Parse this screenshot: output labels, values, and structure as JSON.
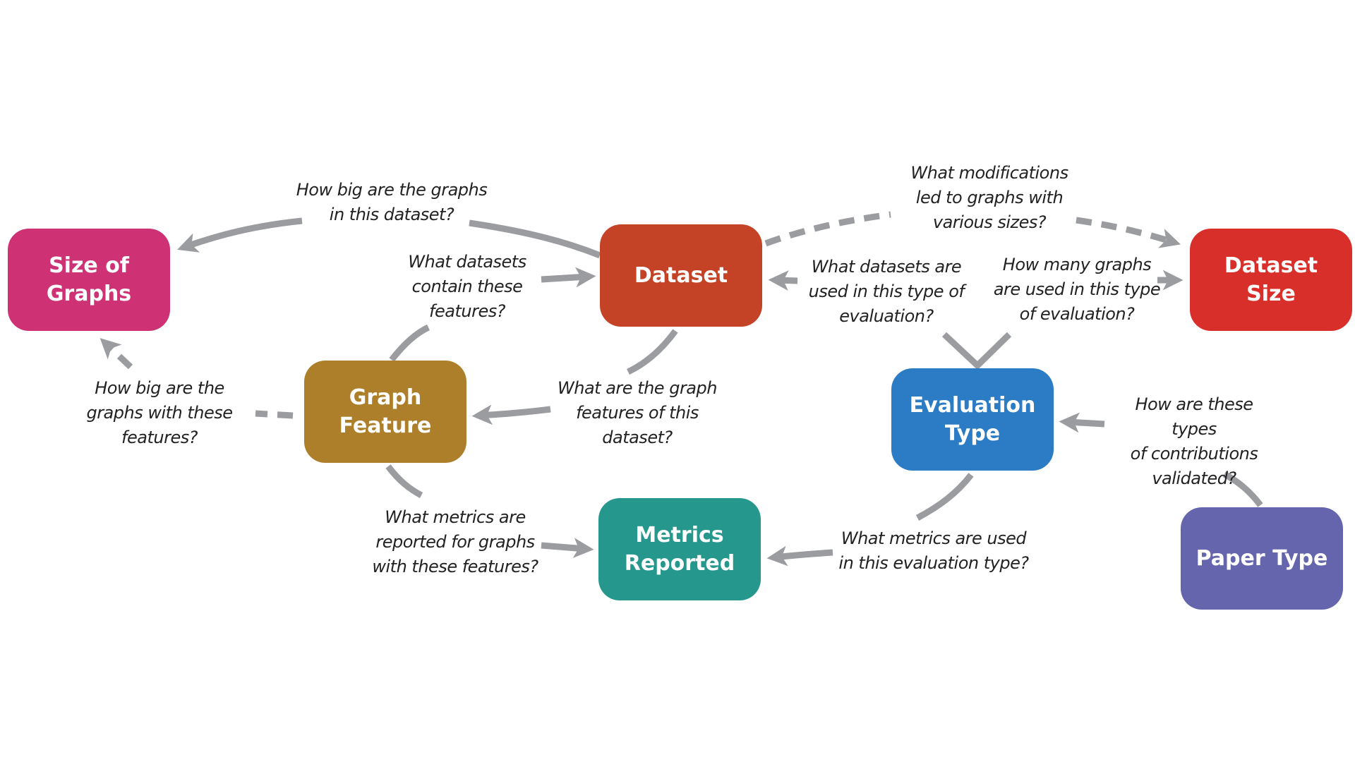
{
  "colors": {
    "edge": "#9a9c9f",
    "size_of_graphs": "#CE3174",
    "dataset": "#C44326",
    "dataset_size": "#D82F2B",
    "graph_feature": "#AD7F2B",
    "evaluation_type": "#2B7CC4",
    "metrics_reported": "#26978C",
    "paper_type": "#6465AD"
  },
  "nodes": {
    "size_of_graphs": "Size of\nGraphs",
    "dataset": "Dataset",
    "dataset_size": "Dataset Size",
    "graph_feature": "Graph\nFeature",
    "evaluation_type": "Evaluation\nType",
    "metrics_reported": "Metrics\nReported",
    "paper_type": "Paper Type"
  },
  "questions": {
    "dataset_to_size": "How big are the graphs\nin this dataset?",
    "feature_to_dataset": "What datasets\ncontain these\nfeatures?",
    "modifications_sizes": "What modifications\nled to graphs with\nvarious sizes?",
    "eval_to_dataset": "What datasets are\nused in this type of\nevaluation?",
    "eval_to_dataset_size": "How many graphs\nare used in this type\nof evaluation?",
    "feature_to_size": "How big are the\ngraphs with these\nfeatures?",
    "dataset_to_feature": "What are the graph\nfeatures of this\ndataset?",
    "paper_to_eval": "How are these types\nof contributions\nvalidated?",
    "feature_to_metrics": "What metrics are\nreported for graphs\nwith these features?",
    "eval_to_metrics": "What metrics are used\nin this evaluation type?"
  }
}
